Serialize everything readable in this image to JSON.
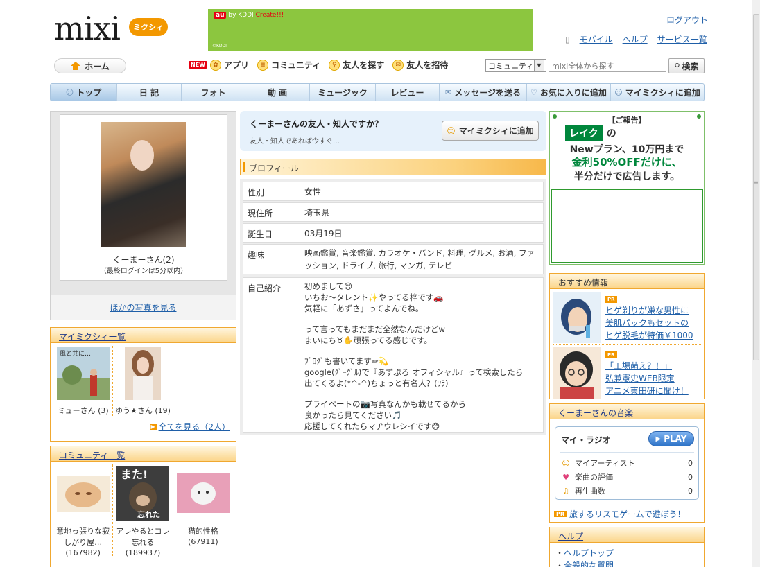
{
  "header": {
    "logo_text": "mixi",
    "logo_sub": "ミクシィ",
    "logout": "ログアウト",
    "links": [
      "モバイル",
      "ヘルプ",
      "サービス一覧"
    ],
    "ad_brand": "au",
    "ad_brand_suffix": "by KDDI",
    "ad_text": "Create!!!",
    "ad_corner": "©KDDI"
  },
  "subnav": {
    "home": "ホーム",
    "new_badge": "NEW",
    "items": [
      "アプリ",
      "コミュニティ",
      "友人を探す",
      "友人を招待"
    ],
    "search_scope": "コミュニティ",
    "search_placeholder": "mixi全体から探す",
    "search_button": "検索"
  },
  "mainnav": {
    "items": [
      "トップ",
      "日 記",
      "フォト",
      "動 画",
      "ミュージック",
      "レビュー",
      "メッセージを送る",
      "お気に入りに追加",
      "マイミクシィに追加"
    ]
  },
  "profile_card": {
    "name": "くーまーさん(2)",
    "last_login": "（最終ログインは5分以内）",
    "more_photos": "ほかの写真を見る"
  },
  "mymixi": {
    "title": "マイミクシィ一覧",
    "friends": [
      {
        "name": "ミューさん (3)",
        "thumb_caption": "風と共に…"
      },
      {
        "name": "ゆう★さん (19)"
      }
    ],
    "see_all": "全てを見る（2人）"
  },
  "community": {
    "title": "コミュニティ一覧",
    "items": [
      {
        "name": "意地っ張りな寂しがり屋…",
        "count": "(167982)"
      },
      {
        "name": "アレやるとコレ忘れる",
        "count": "(189937)",
        "thumb_top": "また!",
        "thumb_bottom": "忘れた"
      },
      {
        "name": "猫的性格",
        "count": "(67911)"
      }
    ]
  },
  "friend_prompt": {
    "question": "くーまーさんの友人・知人ですか？",
    "sub": "友人・知人であれば今すぐ…",
    "button": "マイミクシィに追加"
  },
  "profile": {
    "header": "プロフィール",
    "rows": [
      {
        "key": "性別",
        "value": "女性"
      },
      {
        "key": "現住所",
        "value": "埼玉県"
      },
      {
        "key": "誕生日",
        "value": "03月19日"
      },
      {
        "key": "趣味",
        "value": "映画鑑賞, 音楽鑑賞, カラオケ・バンド, 料理, グルメ, お酒, ファッション, ドライブ, 旅行, マンガ, テレビ"
      }
    ],
    "intro_key": "自己紹介",
    "intro": [
      "初めまして😊",
      "いちお～タレント✨やってる梓です🚗",
      "気軽に「あずさ」ってよんでね。",
      "",
      "って言ってもまだまだ全然なんだけどw",
      "まいにち♉✋頑張ってる感じです。",
      "",
      "ﾌﾞﾛｸﾞも書いてます✏💫",
      "google(ｸﾞｰｸﾞﾙ)で『あずぷろ オフィシャル』って検索したら",
      "出てくるよ(*^-^)ちょっと有名人？(ﾜﾗ)",
      "",
      "プライベートの📷写真なんかも載せてるから",
      "良かったら見てください🎵",
      "応援してくれたらマヂウレシイです😊"
    ]
  },
  "ad_right": {
    "notice": "【ご報告】",
    "logo": "レイク",
    "logo_suffix": "の",
    "line1": "Newプラン、10万円まで",
    "line2": "金利50%OFFだけに、",
    "line3": "半分だけで広告します。"
  },
  "recommend": {
    "title": "おすすめ情報",
    "pr": "PR",
    "items": [
      {
        "lines": [
          "ヒゲ剃りが嫌な男性に",
          "美肌パックもセットの",
          "ヒゲ脱毛が特価￥1000"
        ]
      },
      {
        "lines": [
          "「工場萌え？！」",
          "弘兼憲史WEB限定",
          "アニメ東田研に聞け！"
        ]
      }
    ]
  },
  "music": {
    "title": "くーまーさんの音楽",
    "radio": "マイ・ラジオ",
    "play": "PLAY",
    "stats": [
      {
        "label": "マイアーティスト",
        "value": "0",
        "icon": "artist-icon"
      },
      {
        "label": "楽曲の評価",
        "value": "0",
        "icon": "heart-icon"
      },
      {
        "label": "再生曲数",
        "value": "0",
        "icon": "note-icon"
      }
    ],
    "pr_badge": "PR",
    "pr_link": "旅するリスモゲームで遊ぼう！"
  },
  "help": {
    "title": "ヘルプ",
    "items": [
      "ヘルプトップ",
      "全般的な質問"
    ]
  }
}
